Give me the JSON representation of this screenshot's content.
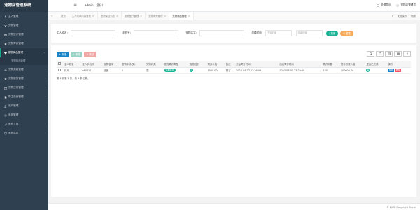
{
  "brand": {
    "title": "宠物店管理系统"
  },
  "sidebar": {
    "items": [
      {
        "label": "主人管理",
        "icon": "user-icon"
      },
      {
        "label": "宠物管理",
        "icon": "paw-icon"
      },
      {
        "label": "宠物医疗管理",
        "icon": "medkit-icon"
      },
      {
        "label": "宠物寄养管理",
        "icon": "home-icon"
      },
      {
        "label": "宠物商品管理",
        "icon": "heart-icon"
      },
      {
        "label": "宠物美容管理",
        "icon": "scissors-icon"
      },
      {
        "label": "宠物服务管理",
        "icon": "star-icon"
      },
      {
        "label": "宠物日常管理",
        "icon": "calendar-icon"
      },
      {
        "label": "帮主页面管理",
        "icon": "file-icon"
      },
      {
        "label": "用户管理",
        "icon": "users-icon"
      },
      {
        "label": "系统管理",
        "icon": "gear-icon"
      },
      {
        "label": "系统工具",
        "icon": "tool-icon"
      },
      {
        "label": "系统监控",
        "icon": "monitor-icon"
      }
    ],
    "active_sub": "宠物商品管理"
  },
  "topbar": {
    "hamburger_icon": "hamburger-icon",
    "greeting": "admin，您好！",
    "fullscreen_label": "全屏显示",
    "user_label": "宠物店管理员"
  },
  "tabs": {
    "items": [
      {
        "label": "首页",
        "active": false
      },
      {
        "label": "主人简单内容管理",
        "active": false
      },
      {
        "label": "宠物保险列表",
        "active": false
      },
      {
        "label": "宠物医疗管理",
        "active": false
      },
      {
        "label": "宠物寄养管理",
        "active": false
      },
      {
        "label": "宠物商品管理",
        "active": true
      }
    ],
    "close_ops_label": "关闭操作",
    "refresh_label": "刷新"
  },
  "search": {
    "owner_name_label": "主人姓名：",
    "owner_name_value": "",
    "phone_label": "手机号：",
    "phone_value": "",
    "pet_name_label": "宠物名字：",
    "pet_name_value": "",
    "created_label": "创建时间：",
    "start_placeholder": "开始时间",
    "dash": "-",
    "end_placeholder": "结束时间",
    "search_btn": "搜索",
    "reset_btn": "重置"
  },
  "toolbar": {
    "add_label": "新增",
    "edit_label": "修改",
    "delete_label": "删除"
  },
  "table": {
    "columns": [
      "",
      "主人姓名",
      "主人手机号",
      "宠物名字",
      "宠物年龄(岁)",
      "宠物种类",
      "宠物寄养类型",
      "宠物性别",
      "寄养价格",
      "备注",
      "开始寄养时间",
      "结束寄养时间",
      "寄养天数",
      "寄养所需价格",
      "是否已完成",
      "操作"
    ],
    "rows": [
      {
        "owner": "林凡",
        "phone": "080812",
        "pet": "团团",
        "age": "2",
        "species": "猫",
        "boarding_type": "短期寄养",
        "gender": "公",
        "price": "1000.00",
        "note": "撒了",
        "start": "2023-04-27 23:29:09",
        "end": "2023-08-05 23:29:09",
        "days": "100",
        "total": "100000.00",
        "done": "是",
        "edit": "编辑",
        "del": "删除"
      }
    ]
  },
  "pager": {
    "text": "第 1 到第 1 条，共 1 条记录。"
  },
  "footer": {
    "text": "© 2022 Copyright Rigrui"
  }
}
